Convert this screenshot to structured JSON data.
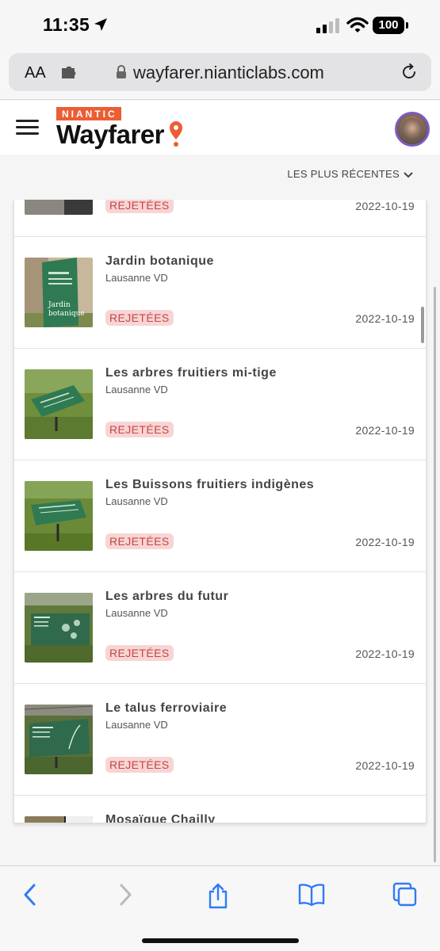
{
  "status_bar": {
    "time": "11:35",
    "battery": "100"
  },
  "browser": {
    "aa_label": "AA",
    "url": "wayfarer.nianticlabs.com"
  },
  "header": {
    "brand_top": "NIANTIC",
    "brand_name": "Wayfarer"
  },
  "sort": {
    "label": "LES PLUS RÉCENTES"
  },
  "list": {
    "partial_top": {
      "status": "REJETÉES",
      "date": "2022-10-19"
    },
    "items": [
      {
        "title": "Jardin botanique",
        "city": "Lausanne VD",
        "status": "REJETÉES",
        "date": "2022-10-19"
      },
      {
        "title": "Les arbres fruitiers mi-tige",
        "city": "Lausanne VD",
        "status": "REJETÉES",
        "date": "2022-10-19"
      },
      {
        "title": "Les Buissons fruitiers indigènes",
        "city": "Lausanne VD",
        "status": "REJETÉES",
        "date": "2022-10-19"
      },
      {
        "title": "Les arbres du futur",
        "city": "Lausanne VD",
        "status": "REJETÉES",
        "date": "2022-10-19"
      },
      {
        "title": "Le talus ferroviaire",
        "city": "Lausanne VD",
        "status": "REJETÉES",
        "date": "2022-10-19"
      },
      {
        "title": "Mosaïque Chailly"
      }
    ]
  },
  "colors": {
    "brand_orange": "#ec5d34",
    "badge_bg": "#f7d5d5",
    "badge_text": "#c94444",
    "toolbar_blue": "#2f7bf5",
    "sign_green": "#2f7a52"
  },
  "toolbar": {
    "icons": [
      "back-icon",
      "forward-icon",
      "share-icon",
      "bookmarks-icon",
      "tabs-icon"
    ]
  }
}
